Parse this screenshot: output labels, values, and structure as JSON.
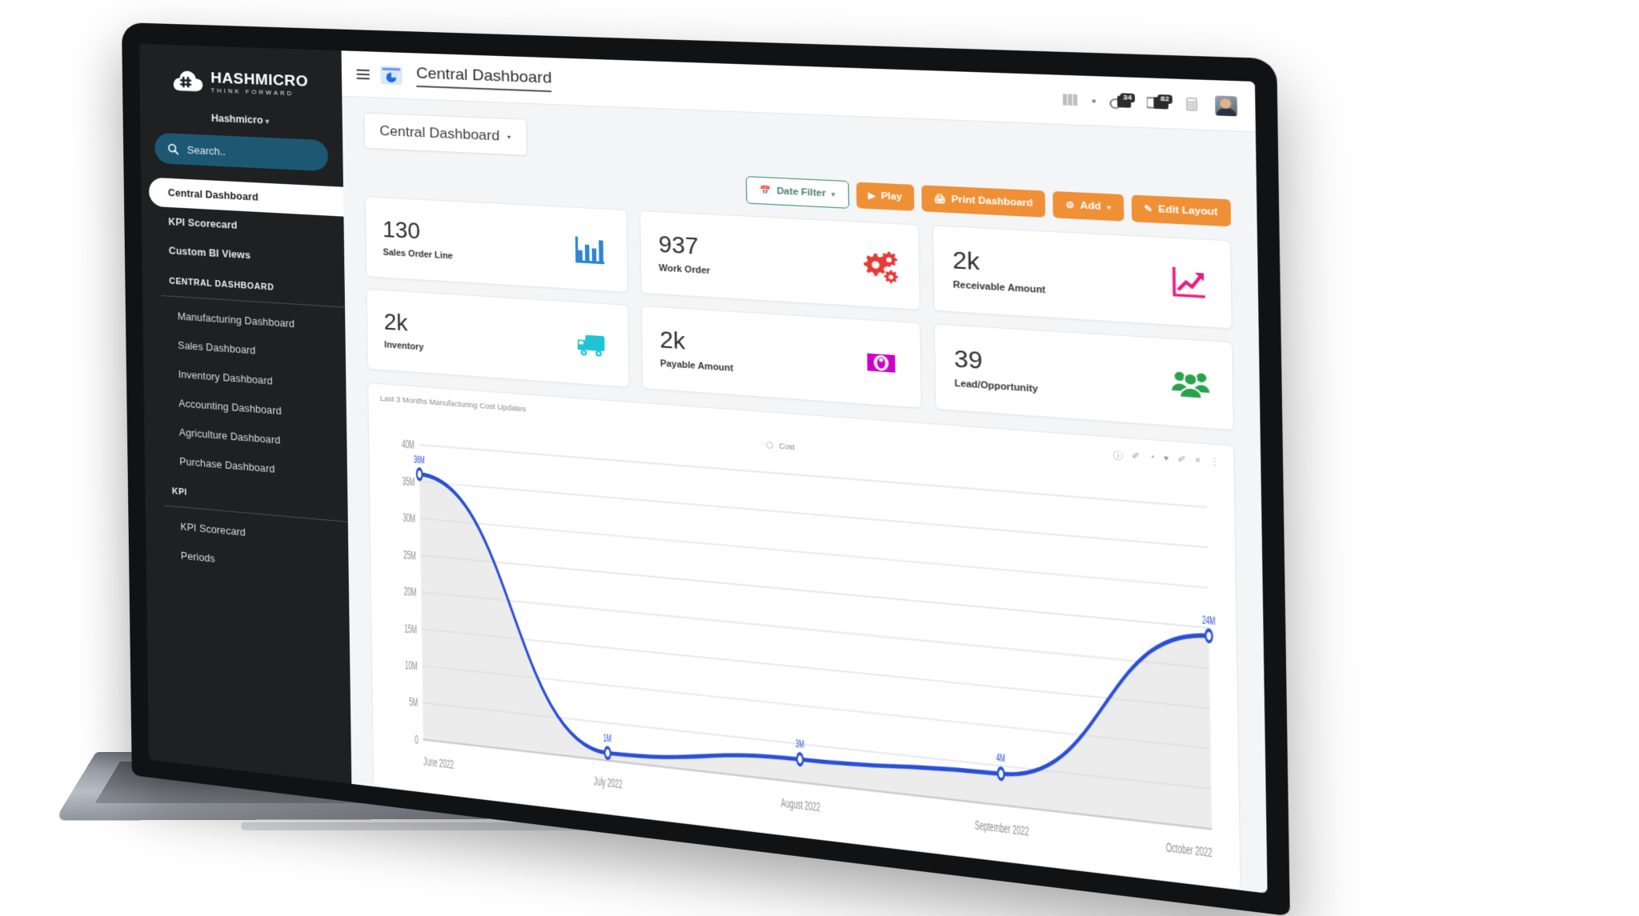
{
  "brand": {
    "logo_main": "HASHMICRO",
    "logo_main_bold": "HASH",
    "logo_main_thin": "MICRO",
    "logo_sub": "THINK FORWARD"
  },
  "sidebar": {
    "org": "Hashmicro",
    "org_caret": "▾",
    "search_placeholder": "Search..",
    "items": [
      {
        "label": "Central Dashboard",
        "active": true,
        "type": "item"
      },
      {
        "label": "KPI Scorecard",
        "active": false,
        "type": "item-bold"
      },
      {
        "label": "Custom BI Views",
        "active": false,
        "type": "item-bold"
      },
      {
        "label": "CENTRAL DASHBOARD",
        "active": false,
        "type": "section"
      },
      {
        "label": "Manufacturing Dashboard",
        "active": false,
        "type": "sub"
      },
      {
        "label": "Sales Dashboard",
        "active": false,
        "type": "sub"
      },
      {
        "label": "Inventory Dashboard",
        "active": false,
        "type": "sub"
      },
      {
        "label": "Accounting Dashboard",
        "active": false,
        "type": "sub"
      },
      {
        "label": "Agriculture Dashboard",
        "active": false,
        "type": "sub"
      },
      {
        "label": "Purchase Dashboard",
        "active": false,
        "type": "sub"
      },
      {
        "label": "KPI",
        "active": false,
        "type": "section"
      },
      {
        "label": "KPI Scorecard",
        "active": false,
        "type": "sub"
      },
      {
        "label": "Periods",
        "active": false,
        "type": "sub"
      }
    ]
  },
  "topbar": {
    "title": "Central Dashboard",
    "menu_icon": "hamburger-icon",
    "app_icon": "dashboard-app-icon",
    "icons": [
      {
        "name": "grid-icon"
      },
      {
        "name": "dot-icon"
      }
    ],
    "badge_messages": "34",
    "badge_activities": "82",
    "calculator_icon": "calculator-icon",
    "avatar": "user-avatar"
  },
  "breadcrumb": {
    "label": "Central Dashboard",
    "caret": "▾"
  },
  "actions": {
    "date_filter": {
      "label": "Date Filter",
      "icon": "calendar-icon",
      "caret": "▾"
    },
    "play": {
      "label": "Play",
      "icon": "play-icon"
    },
    "print": {
      "label": "Print Dashboard",
      "icon": "print-icon"
    },
    "add": {
      "label": "Add",
      "icon": "plus-circle-icon",
      "caret": "▾"
    },
    "edit_layout": {
      "label": "Edit Layout",
      "icon": "pencil-icon"
    }
  },
  "kpi_cards": [
    {
      "value": "130",
      "label": "Sales Order Line",
      "icon": "bar-chart-icon",
      "color": "#2e86d1"
    },
    {
      "value": "937",
      "label": "Work Order",
      "icon": "gears-icon",
      "color": "#e63a35"
    },
    {
      "value": "2k",
      "label": "Receivable Amount",
      "icon": "trending-up-icon",
      "color": "#e8197f"
    },
    {
      "value": "2k",
      "label": "Inventory",
      "icon": "truck-icon",
      "color": "#1fc4d4"
    },
    {
      "value": "2k",
      "label": "Payable Amount",
      "icon": "banknote-icon",
      "color": "#cc00cc"
    },
    {
      "value": "39",
      "label": "Lead/Opportunity",
      "icon": "people-icon",
      "color": "#2aa14a"
    }
  ],
  "chart_panel": {
    "title": "Last 3 Months Manufacturing Cost Updates",
    "tools": [
      {
        "name": "info-icon",
        "glyph": "ⓘ"
      },
      {
        "name": "pencil-icon",
        "glyph": "✐"
      },
      {
        "name": "palette-icon",
        "glyph": "◔"
      },
      {
        "name": "palette-caret",
        "glyph": "▾"
      },
      {
        "name": "edit-icon",
        "glyph": "✐"
      },
      {
        "name": "close-icon",
        "glyph": "×"
      },
      {
        "name": "more-vertical-icon",
        "glyph": "⋮"
      }
    ]
  },
  "chart_data": {
    "type": "area",
    "title": "Last 3 Months Manufacturing Cost Updates",
    "xlabel": "",
    "ylabel": "",
    "legend": [
      "Cost"
    ],
    "legend_position": "top-center",
    "grid": true,
    "categories": [
      "June 2022",
      "July 2022",
      "August 2022",
      "September 2022",
      "October 2022"
    ],
    "series": [
      {
        "name": "Cost",
        "color": "#2a4fd6",
        "values": [
          36000000,
          1000000,
          3000000,
          4000000,
          24000000
        ],
        "point_labels": [
          "36M",
          "1M",
          "3M",
          "4M",
          "24M"
        ]
      }
    ],
    "ylim": [
      0,
      40000000
    ],
    "ytick_labels": [
      "0",
      "5M",
      "10M",
      "15M",
      "20M",
      "25M",
      "30M",
      "35M",
      "40M"
    ],
    "ytick_values": [
      0,
      5000000,
      10000000,
      15000000,
      20000000,
      25000000,
      30000000,
      35000000,
      40000000
    ]
  }
}
